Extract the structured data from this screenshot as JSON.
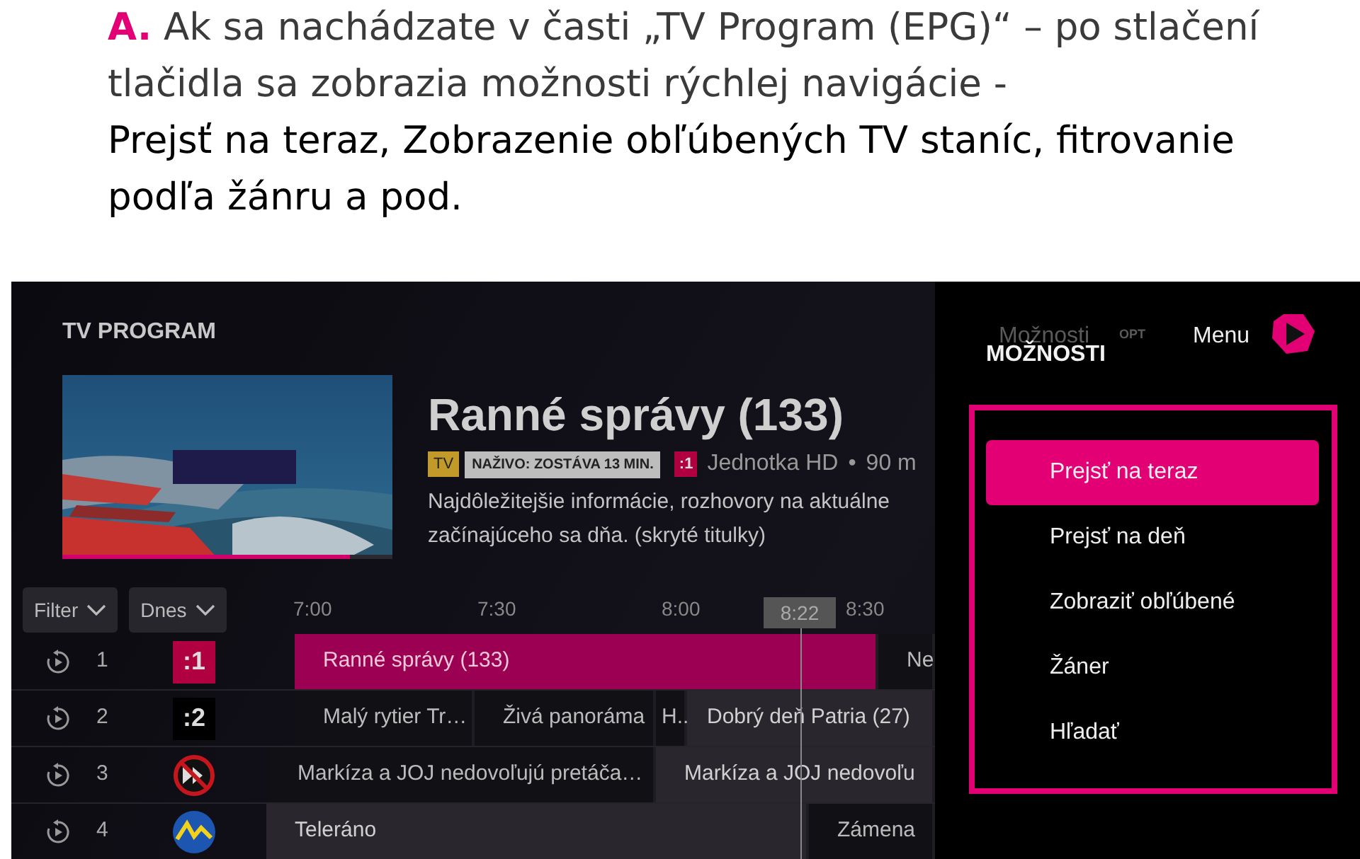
{
  "instruction": {
    "label": "A.",
    "text": "Ak sa nachádzate v časti „TV Program (EPG)“ – po stlačení tlačidla sa zobrazia možnosti rýchlej navigácie -",
    "emphasis": "Prejsť na teraz, Zobrazenie obľúbených TV  staníc, fitrovanie podľa žánru a pod."
  },
  "tv_screen": {
    "section_title": "TV PROGRAM",
    "preview": {
      "kind": "picture",
      "level": 0.87
    },
    "programme": {
      "title": "Ranné správy (133)",
      "type_tag": "TV",
      "live_tag": "NAŽIVO: ZOSTÁVA 13 MIN.",
      "channel_logo": ":1",
      "channel": "Jednotka HD",
      "separator": "•",
      "duration": "90 m",
      "description_lines": [
        "Najdôležitejšie informácie, rozhovory na aktuálne",
        "začínajúceho sa dňa. (skryté titulky)"
      ]
    },
    "filters": [
      {
        "label": "Filter"
      },
      {
        "label": "Dnes"
      }
    ],
    "timeline": {
      "times": [
        "7:00",
        "7:30",
        "8:00",
        "8:30"
      ],
      "now": "8:22"
    },
    "channels": [
      {
        "number": "1",
        "logo": {
          "kind": "text",
          "text": ":1",
          "color": "#b0003f"
        },
        "programmes": [
          {
            "title": "Ranné správy (133)",
            "selected": true,
            "on_air": true
          },
          {
            "title": "Ne",
            "selected": false,
            "on_air": false
          }
        ]
      },
      {
        "number": "2",
        "logo": {
          "kind": "text",
          "text": ":2",
          "color": "#000000"
        },
        "programmes": [
          {
            "title": "Malý rytier Tr…",
            "selected": false,
            "on_air": false
          },
          {
            "title": "Živá panoráma",
            "selected": false,
            "on_air": false
          },
          {
            "title": "H..",
            "selected": false,
            "on_air": false
          },
          {
            "title": "Dobrý deň Patria (27)",
            "selected": false,
            "on_air": true
          }
        ]
      },
      {
        "number": "3",
        "logo": {
          "kind": "no-skip"
        },
        "programmes": [
          {
            "title": "Markíza a JOJ nedovoľujú pretáča…",
            "selected": false,
            "on_air": false
          },
          {
            "title": "Markíza a JOJ nedovoľu",
            "selected": false,
            "on_air": true
          }
        ]
      },
      {
        "number": "4",
        "logo": {
          "kind": "wave"
        },
        "programmes": [
          {
            "title": "Teleráno",
            "selected": false,
            "on_air": true
          },
          {
            "title": "Zámena",
            "selected": false,
            "on_air": false
          }
        ]
      }
    ]
  },
  "options_panel": {
    "hint": "Možnosti",
    "hint_key": "OPT",
    "title": "MOŽNOSTI",
    "menu": "Menu",
    "items": [
      {
        "label": "Prejsť na teraz",
        "selected": true
      },
      {
        "label": "Prejsť na deň",
        "selected": false
      },
      {
        "label": "Zobraziť obľúbené",
        "selected": false
      },
      {
        "label": "Žáner",
        "selected": false
      },
      {
        "label": "Hľadať",
        "selected": false
      }
    ]
  }
}
